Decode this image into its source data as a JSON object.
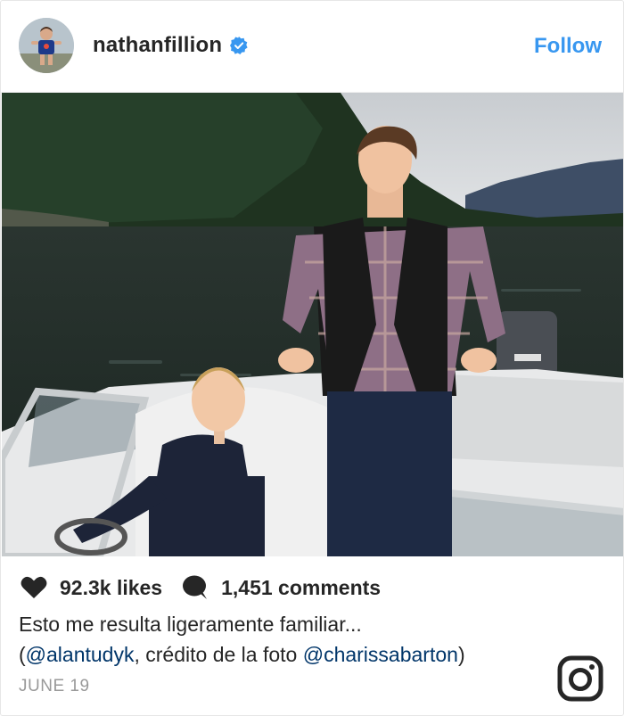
{
  "header": {
    "username": "nathanfillion",
    "follow_label": "Follow",
    "verified_icon": "verified-badge-icon"
  },
  "stats": {
    "likes": "92.3k likes",
    "comments": "1,451 comments"
  },
  "caption": {
    "line1": "Esto me resulta ligeramente familiar...",
    "open_paren": "(",
    "mention1": "@alantudyk",
    "middle_text": ", crédito de la foto ",
    "mention2": "@charissabarton",
    "close_paren": ")"
  },
  "date": "JUNE 19",
  "colors": {
    "accent": "#3897f0",
    "text": "#262626",
    "muted": "#999999",
    "mention": "#003569"
  }
}
